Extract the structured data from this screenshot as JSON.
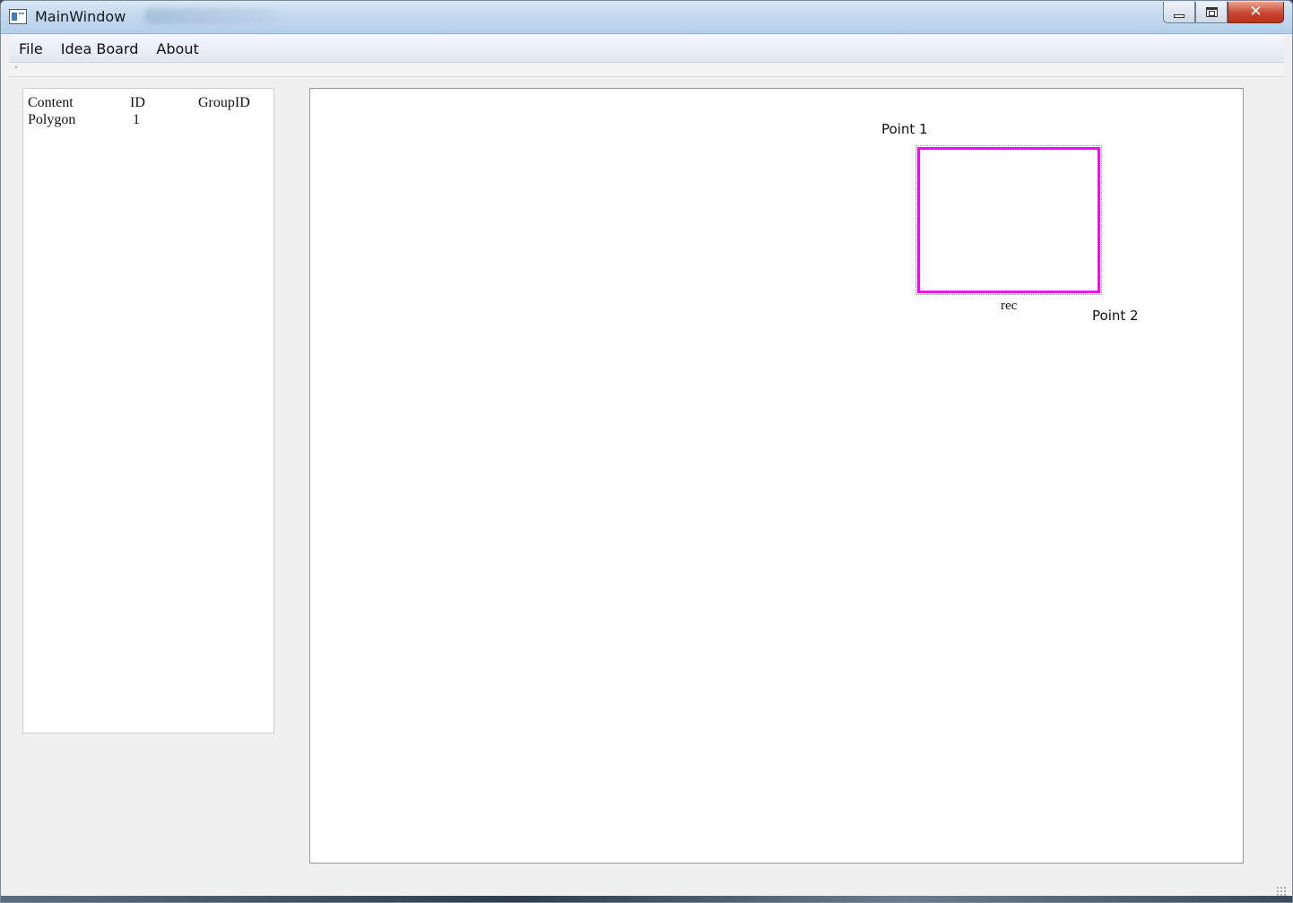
{
  "window": {
    "title": "MainWindow",
    "close_glyph": "✕"
  },
  "menu": [
    "File",
    "Idea Board",
    "About"
  ],
  "list": {
    "headers": {
      "content": "Content",
      "id": "ID",
      "group_id": "GroupID"
    },
    "rows": [
      {
        "content": "Polygon",
        "id": "1",
        "group_id": ""
      }
    ]
  },
  "canvas": {
    "point1_label": "Point 1",
    "point2_label": "Point 2",
    "shape_label": "rec",
    "shape_color": "#ff00ff"
  }
}
